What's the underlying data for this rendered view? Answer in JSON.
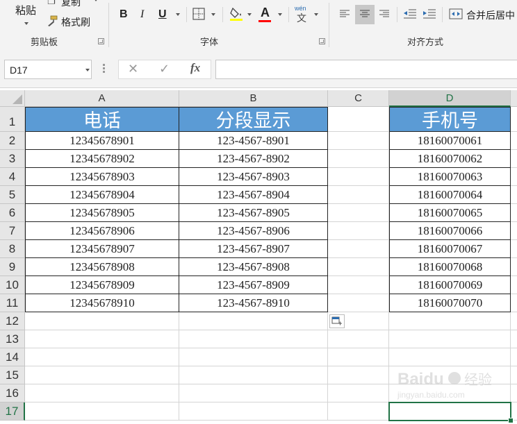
{
  "ribbon": {
    "clipboard": {
      "paste_label": "粘贴",
      "copy_label": "复制",
      "format_painter_label": "格式刷",
      "group_title": "剪贴板"
    },
    "font": {
      "bold": "B",
      "italic": "I",
      "underline": "U",
      "font_color_letter": "A",
      "phonetic_top": "wén",
      "phonetic_bottom": "文",
      "group_title": "字体"
    },
    "alignment": {
      "merge_label": "合并后居中",
      "group_title": "对齐方式"
    }
  },
  "formula_bar": {
    "name_box_value": "D17",
    "cancel_glyph": "✕",
    "enter_glyph": "✓",
    "fx_label": "fx",
    "formula_value": ""
  },
  "sheet": {
    "columns": [
      "A",
      "B",
      "C",
      "D"
    ],
    "rows": [
      "1",
      "2",
      "3",
      "4",
      "5",
      "6",
      "7",
      "8",
      "9",
      "10",
      "11",
      "12",
      "13",
      "14",
      "15",
      "16",
      "17"
    ],
    "selected_column": "D",
    "selected_row": "17",
    "header_row": {
      "A": "电话",
      "B": "分段显示",
      "D": "手机号"
    },
    "data": [
      {
        "A": "12345678901",
        "B": "123-4567-8901",
        "D": "18160070061"
      },
      {
        "A": "12345678902",
        "B": "123-4567-8902",
        "D": "18160070062"
      },
      {
        "A": "12345678903",
        "B": "123-4567-8903",
        "D": "18160070063"
      },
      {
        "A": "12345678904",
        "B": "123-4567-8904",
        "D": "18160070064"
      },
      {
        "A": "12345678905",
        "B": "123-4567-8905",
        "D": "18160070065"
      },
      {
        "A": "12345678906",
        "B": "123-4567-8906",
        "D": "18160070066"
      },
      {
        "A": "12345678907",
        "B": "123-4567-8907",
        "D": "18160070067"
      },
      {
        "A": "12345678908",
        "B": "123-4567-8908",
        "D": "18160070068"
      },
      {
        "A": "12345678909",
        "B": "123-4567-8909",
        "D": "18160070069"
      },
      {
        "A": "12345678910",
        "B": "123-4567-8910",
        "D": "18160070070"
      }
    ],
    "header_fill": "#5b9bd5",
    "selection_color": "#217346"
  },
  "watermark": {
    "brand": "Baidu",
    "suffix": "经验",
    "url": "jingyan.baidu.com"
  }
}
